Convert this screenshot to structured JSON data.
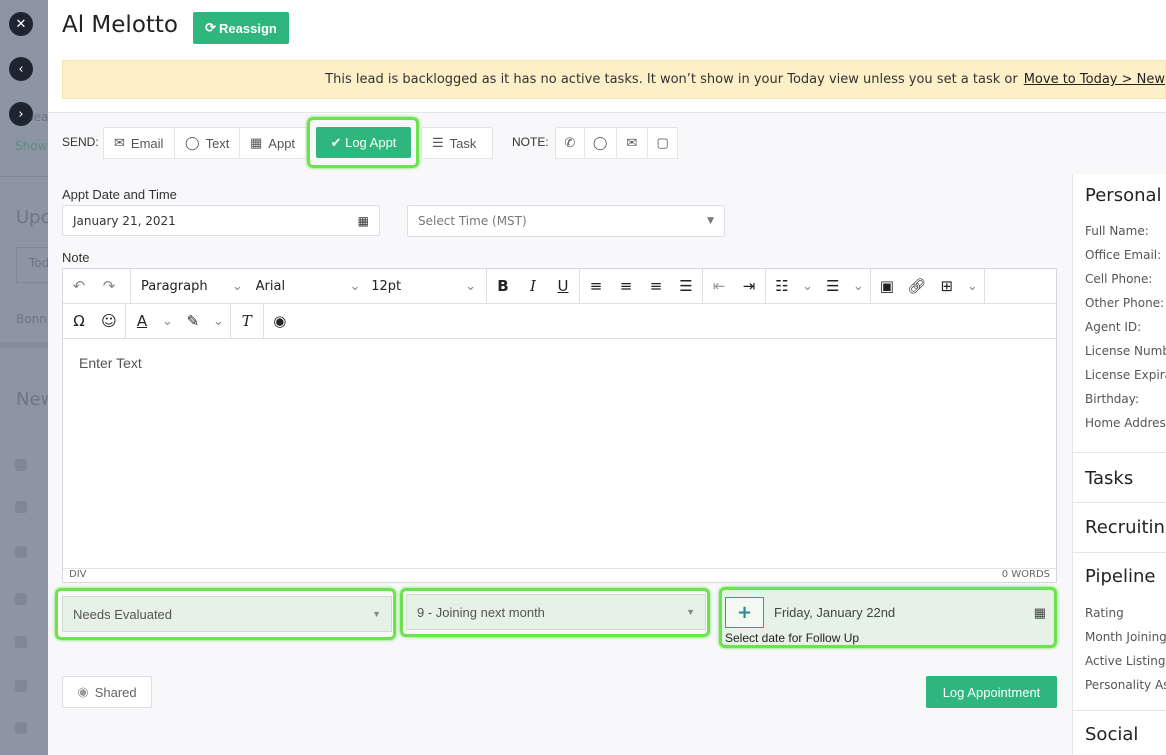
{
  "background": {
    "search_partial": "Sea",
    "show_partial": "Show",
    "upcoming_partial": "Upc",
    "today_tab_partial": "Tod",
    "bonnie_partial": "Bonni",
    "new_partial": "New"
  },
  "header": {
    "title": "Al Melotto",
    "reassign_label": "Reassign"
  },
  "banner": {
    "text": "This lead is backlogged as it has no active tasks. It won’t show in your Today view unless you set a task or",
    "link": "Move to Today > New"
  },
  "send_bar": {
    "send_label": "SEND:",
    "email": "Email",
    "text": "Text",
    "appt": "Appt",
    "log_appt": "Log Appt",
    "task": "Task",
    "note_label": "NOTE:"
  },
  "form": {
    "appt_label": "Appt Date and Time",
    "date_value": "January 21, 2021",
    "time_placeholder": "Select Time (MST)",
    "note_label": "Note"
  },
  "editor": {
    "block_format": "Paragraph",
    "font": "Arial",
    "size": "12pt",
    "placeholder": "Enter Text",
    "path": "DIV",
    "word_count": "0 WORDS"
  },
  "status_select": "Needs Evaluated",
  "rating_select": "9 - Joining next month",
  "followup": {
    "date": "Friday, January 22nd",
    "hint": "Select date for Follow Up"
  },
  "footer": {
    "shared": "Shared",
    "submit": "Log Appointment"
  },
  "right": {
    "personal_heading": "Personal D",
    "fields": [
      "Full Name:",
      "Office Email: (",
      "Cell Phone:",
      "Other Phone:",
      "Agent ID:",
      "License Numb",
      "License Expira",
      "Birthday:",
      "Home Address"
    ],
    "tasks": "Tasks",
    "recruiting": "Recruiting",
    "pipeline": "Pipeline",
    "pipeline_fields": [
      "Rating",
      "Month Joining",
      "Active Listing",
      "Personality As"
    ],
    "social": "Social"
  },
  "colors": {
    "accent": "#2eb67d",
    "highlight": "#6be34f",
    "banner": "#fdf0c8"
  }
}
